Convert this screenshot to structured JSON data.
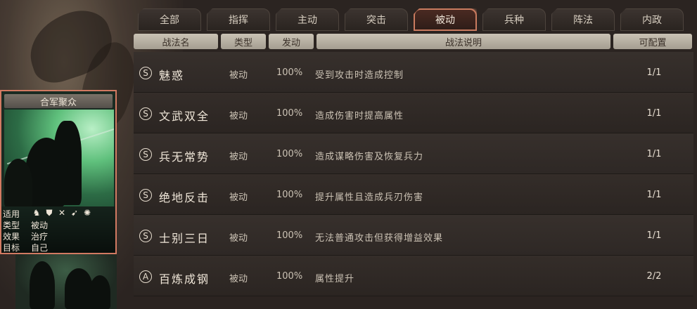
{
  "tabs": [
    {
      "label": "全部",
      "active": false
    },
    {
      "label": "指挥",
      "active": false
    },
    {
      "label": "主动",
      "active": false
    },
    {
      "label": "突击",
      "active": false
    },
    {
      "label": "被动",
      "active": true
    },
    {
      "label": "兵种",
      "active": false
    },
    {
      "label": "阵法",
      "active": false
    },
    {
      "label": "内政",
      "active": false
    }
  ],
  "headers": {
    "name": "战法名",
    "type": "类型",
    "rate": "发动",
    "desc": "战法说明",
    "config": "可配置"
  },
  "rows": [
    {
      "rank": "S",
      "name": "魅惑",
      "type": "被动",
      "rate": "100%",
      "desc": "受到攻击时造成控制",
      "config": "1/1"
    },
    {
      "rank": "S",
      "name": "文武双全",
      "type": "被动",
      "rate": "100%",
      "desc": "造成伤害时提高属性",
      "config": "1/1"
    },
    {
      "rank": "S",
      "name": "兵无常势",
      "type": "被动",
      "rate": "100%",
      "desc": "造成谋略伤害及恢复兵力",
      "config": "1/1"
    },
    {
      "rank": "S",
      "name": "绝地反击",
      "type": "被动",
      "rate": "100%",
      "desc": "提升属性且造成兵刃伤害",
      "config": "1/1"
    },
    {
      "rank": "S",
      "name": "士别三日",
      "type": "被动",
      "rate": "100%",
      "desc": "无法普通攻击但获得增益效果",
      "config": "1/1"
    },
    {
      "rank": "A",
      "name": "百炼成钢",
      "type": "被动",
      "rate": "100%",
      "desc": "属性提升",
      "config": "2/2"
    }
  ],
  "card": {
    "title": "合军聚众",
    "info": [
      {
        "key": "适用",
        "value": ""
      },
      {
        "key": "类型",
        "value": "被动"
      },
      {
        "key": "效果",
        "value": "治疗"
      },
      {
        "key": "目标",
        "value": "自己"
      }
    ],
    "troop_icons": [
      "cavalry-icon",
      "shield-icon",
      "crossbow-icon",
      "spear-icon",
      "siege-icon"
    ]
  }
}
